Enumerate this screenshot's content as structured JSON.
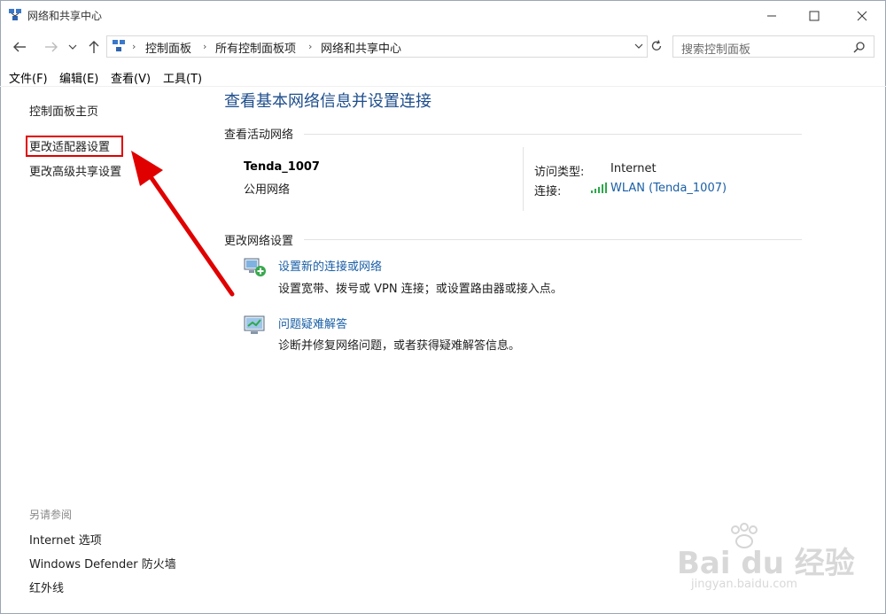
{
  "window": {
    "title": "网络和共享中心",
    "controls": {
      "minimize": "—",
      "maximize": "☐",
      "close": "✕"
    }
  },
  "address": {
    "crumbs": [
      "控制面板",
      "所有控制面板项",
      "网络和共享中心"
    ],
    "search_placeholder": "搜索控制面板"
  },
  "menu": [
    "文件(F)",
    "编辑(E)",
    "查看(V)",
    "工具(T)"
  ],
  "left_pane": {
    "home": "控制面板主页",
    "adapter": "更改适配器设置",
    "advanced": "更改高级共享设置",
    "see_also": "另请参阅",
    "see_also_links": [
      "Internet 选项",
      "Windows Defender 防火墙",
      "红外线"
    ]
  },
  "main": {
    "title": "查看基本网络信息并设置连接",
    "active_header": "查看活动网络",
    "network_name": "Tenda_1007",
    "network_type": "公用网络",
    "access_label": "访问类型:",
    "access_value": "Internet",
    "connection_label": "连接:",
    "connection_value": "WLAN (Tenda_1007)",
    "change_header": "更改网络设置",
    "options": [
      {
        "title": "设置新的连接或网络",
        "desc": "设置宽带、拨号或 VPN 连接；或设置路由器或接入点。"
      },
      {
        "title": "问题疑难解答",
        "desc": "诊断并修复网络问题，或者获得疑难解答信息。"
      }
    ]
  },
  "watermark": {
    "brand": "Bai du 经验",
    "url": "jingyan.baidu.com"
  },
  "colors": {
    "link": "#1a5fa6",
    "title": "#1e4e8c",
    "annotation": "#e00000"
  }
}
